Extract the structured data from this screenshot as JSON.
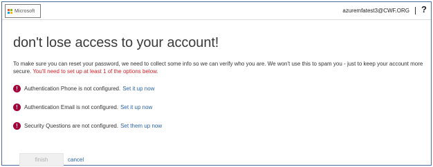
{
  "header": {
    "logo_text": "Microsoft",
    "logo_colors": [
      "#f25022",
      "#7fba00",
      "#00a4ef",
      "#ffb900"
    ],
    "account": "azuremfatest3@CWF.ORG",
    "help_label": "?"
  },
  "main": {
    "title": "don't lose access to your account!",
    "intro": "To make sure you can reset your password, we need to collect some info so we can verify who you are. We won't use this to spam you - just to keep your account more secure.",
    "intro_required": "You'll need to set up at least 1 of the options below.",
    "items": [
      {
        "icon": "!",
        "text": "Authentication Phone is not configured.",
        "link": "Set it up now"
      },
      {
        "icon": "!",
        "text": "Authentication Email is not configured.",
        "link": "Set it up now"
      },
      {
        "icon": "!",
        "text": "Security Questions are not configured.",
        "link": "Set them up now"
      }
    ],
    "finish_label": "finish",
    "cancel_label": "cancel"
  },
  "colors": {
    "alert": "#a4003a",
    "link": "#2b62a6",
    "required_text": "#d81f26"
  }
}
